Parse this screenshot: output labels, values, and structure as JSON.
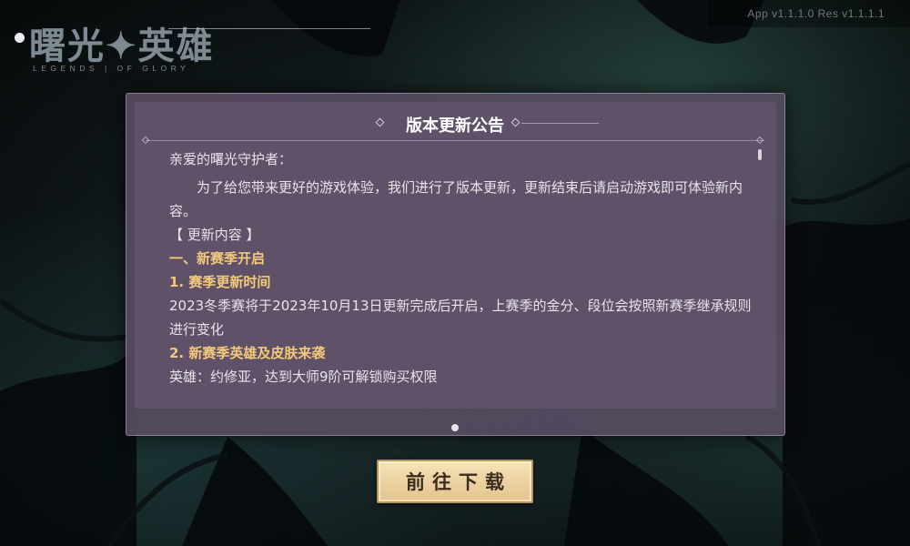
{
  "version_text": "App v1.1.1.0  Res v1.1.1.1",
  "logo": {
    "cn": "曙光✦英雄",
    "en": "LEGENDS | OF GLORY"
  },
  "notice": {
    "title": "版本更新公告",
    "greeting": "亲爱的曙光守护者：",
    "intro": "为了给您带来更好的游戏体验，我们进行了版本更新，更新结束后请启动游戏即可体验新内容。",
    "section_tag": "【 更新内容 】",
    "section1_title": "一、新赛季开启",
    "sub1_title": "1. 赛季更新时间",
    "sub1_body": "2023冬季赛将于2023年10月13日更新完成后开启，上赛季的金分、段位会按照新赛季继承规则进行变化",
    "sub2_title": "2. 新赛季英雄及皮肤来袭",
    "sub2_body": "英雄：约修亚，达到大师9阶可解锁购买权限"
  },
  "download_button": "前往下载",
  "colors": {
    "accent": "#f4c97a",
    "panel": "#584c62",
    "button": "#e9cf9f"
  }
}
